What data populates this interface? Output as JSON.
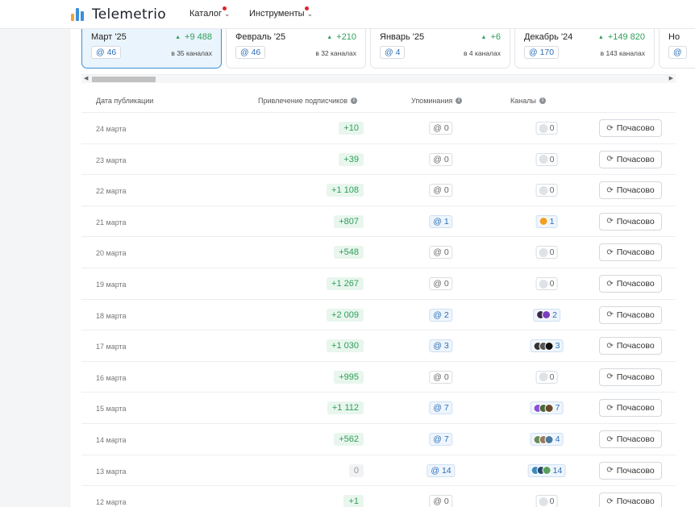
{
  "header": {
    "logo_text": "Telemetrio",
    "nav": [
      {
        "label": "Каталог"
      },
      {
        "label": "Инструменты"
      }
    ],
    "colors": {
      "accent": "#3d8fd9",
      "growth": "#2f9e5a",
      "notification_dot": "#e02424"
    }
  },
  "months": [
    {
      "name": "Март '25",
      "growth": "+9 488",
      "mentions": "@ 46",
      "channels": "в 35 каналах",
      "active": true
    },
    {
      "name": "Февраль '25",
      "growth": "+210",
      "mentions": "@ 46",
      "channels": "в 32 каналах",
      "active": false
    },
    {
      "name": "Январь '25",
      "growth": "+6",
      "mentions": "@ 4",
      "channels": "в 4 каналах",
      "active": false
    },
    {
      "name": "Декабрь '24",
      "growth": "+149 820",
      "mentions": "@ 170",
      "channels": "в 143 каналах",
      "active": false
    },
    {
      "name": "Но",
      "growth": "",
      "mentions": "@",
      "channels": "",
      "active": false
    }
  ],
  "table": {
    "columns": {
      "date": "Дата публикации",
      "subscribers": "Привлечение подписчиков",
      "mentions": "Упоминания",
      "channels": "Каналы"
    },
    "hourly_label": "Почасово",
    "rows": [
      {
        "date": "24 марта",
        "subs": "+10",
        "mentions": "@ 0",
        "channels": "0",
        "avatars": []
      },
      {
        "date": "23 марта",
        "subs": "+39",
        "mentions": "@ 0",
        "channels": "0",
        "avatars": []
      },
      {
        "date": "22 марта",
        "subs": "+1 108",
        "mentions": "@ 0",
        "channels": "0",
        "avatars": []
      },
      {
        "date": "21 марта",
        "subs": "+807",
        "mentions": "@ 1",
        "channels": "1",
        "avatars": [
          "#f0a020"
        ]
      },
      {
        "date": "20 марта",
        "subs": "+548",
        "mentions": "@ 0",
        "channels": "0",
        "avatars": []
      },
      {
        "date": "19 марта",
        "subs": "+1 267",
        "mentions": "@ 0",
        "channels": "0",
        "avatars": []
      },
      {
        "date": "18 марта",
        "subs": "+2 009",
        "mentions": "@ 2",
        "channels": "2",
        "avatars": [
          "#3a2a4a",
          "#7a3fc0"
        ]
      },
      {
        "date": "17 марта",
        "subs": "+1 030",
        "mentions": "@ 3",
        "channels": "3",
        "avatars": [
          "#333333",
          "#555555",
          "#111111"
        ]
      },
      {
        "date": "16 марта",
        "subs": "+995",
        "mentions": "@ 0",
        "channels": "0",
        "avatars": []
      },
      {
        "date": "15 марта",
        "subs": "+1 112",
        "mentions": "@ 7",
        "channels": "7",
        "avatars": [
          "#8a4fd8",
          "#4a6a3a",
          "#6a4a2a"
        ]
      },
      {
        "date": "14 марта",
        "subs": "+562",
        "mentions": "@ 7",
        "channels": "4",
        "avatars": [
          "#6a8a5a",
          "#9a7a5a",
          "#4a7aa0"
        ]
      },
      {
        "date": "13 марта",
        "subs": "0",
        "mentions": "@ 14",
        "channels": "14",
        "avatars": [
          "#3a8ac0",
          "#2a4a6a",
          "#5aa060"
        ]
      },
      {
        "date": "12 марта",
        "subs": "+1",
        "mentions": "@ 0",
        "channels": "0",
        "avatars": []
      }
    ]
  }
}
